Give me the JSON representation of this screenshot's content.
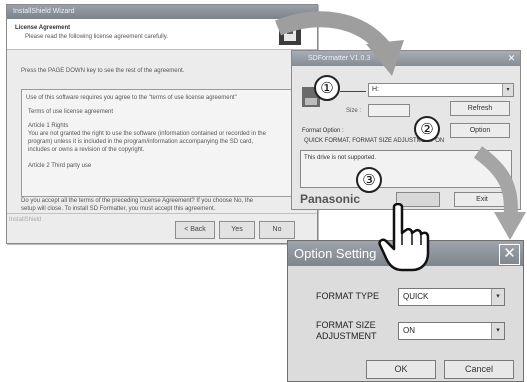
{
  "wizard": {
    "title": "InstallShield Wizard",
    "header_title": "License Agreement",
    "header_sub": "Please read the following license agreement carefully.",
    "instruction": "Press the PAGE DOWN key to see the rest of the agreement.",
    "license_lines": [
      "Use of this software requires you agree to the \"terms of use license agreement\"",
      "Terms of use license agreement",
      "Article 1 Rights",
      "You are not granted the right to use the software (information contained or recorded in the",
      "program) unless it is included in the program/information accompanying the SD card,",
      "includes or owns a revision of the copyright.",
      "Article 2  Third party use"
    ],
    "question_lines": [
      "Do you accept all the terms of the preceding License Agreement? If you choose No, the",
      "setup will close. To install SD Formatter, you must accept this agreement."
    ],
    "footer_brand": "InstallShield",
    "buttons": {
      "back": "< Back",
      "yes": "Yes",
      "no": "No"
    }
  },
  "sdformatter": {
    "title": "SDFormatter V1.0.3",
    "drive_value": "H:",
    "size_label": "Size :",
    "refresh_label": "Refresh",
    "format_option_label": "Format Option :",
    "option_button": "Option",
    "format_option_value": "QUICK FORMAT, FORMAT SIZE ADJUSTMENT ON",
    "status_text": "This drive is not supported.",
    "brand": "Panasonic",
    "exit_label": "Exit"
  },
  "callouts": [
    "①",
    "②",
    "③"
  ],
  "option_dialog": {
    "title": "Option Setting",
    "close_glyph": "✕",
    "format_type_label": "FORMAT TYPE",
    "format_type_value": "QUICK",
    "format_size_label_1": "FORMAT SIZE",
    "format_size_label_2": "ADJUSTMENT",
    "format_size_value": "ON",
    "ok_label": "OK",
    "cancel_label": "Cancel"
  }
}
